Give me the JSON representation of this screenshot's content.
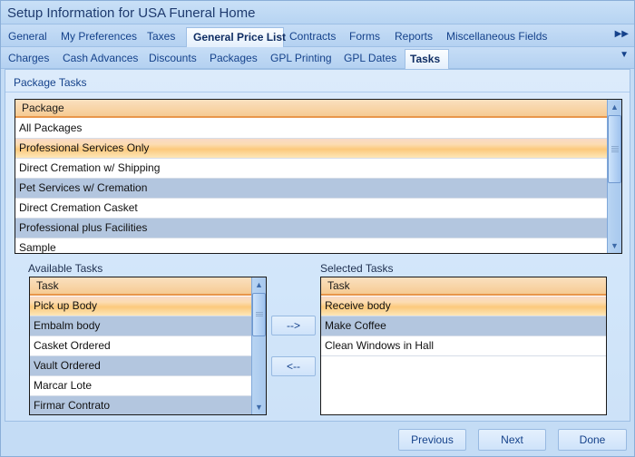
{
  "window": {
    "title": "Setup Information for USA Funeral Home"
  },
  "main_tabs": [
    {
      "label": "General"
    },
    {
      "label": "My Preferences"
    },
    {
      "label": "Taxes"
    },
    {
      "label": "General Price List",
      "active": true
    },
    {
      "label": "Contracts"
    },
    {
      "label": "Forms"
    },
    {
      "label": "Reports"
    },
    {
      "label": "Miscellaneous Fields"
    }
  ],
  "main_tabs_overflow_icon": "double-chevron-right-icon",
  "sub_tabs": [
    {
      "label": "Charges"
    },
    {
      "label": "Cash Advances"
    },
    {
      "label": "Discounts"
    },
    {
      "label": "Packages"
    },
    {
      "label": "GPL Printing"
    },
    {
      "label": "GPL Dates"
    },
    {
      "label": "Tasks",
      "active": true
    }
  ],
  "sub_tabs_overflow_icon": "triangle-down-icon",
  "panel": {
    "title": "Package Tasks",
    "packages": {
      "header": "Package",
      "rows": [
        {
          "label": "All Packages"
        },
        {
          "label": "Professional Services Only",
          "selected": true
        },
        {
          "label": "Direct Cremation w/ Shipping"
        },
        {
          "label": "Pet Services w/ Cremation"
        },
        {
          "label": "Direct Cremation Casket"
        },
        {
          "label": "Professional plus Facilities"
        },
        {
          "label": "Sample"
        }
      ]
    },
    "available": {
      "label": "Available Tasks",
      "header": "Task",
      "rows": [
        {
          "label": "Pick up Body",
          "selected": true
        },
        {
          "label": "Embalm body"
        },
        {
          "label": "Casket Ordered"
        },
        {
          "label": "Vault Ordered"
        },
        {
          "label": "Marcar Lote"
        },
        {
          "label": "Firmar Contrato"
        }
      ]
    },
    "selected": {
      "label": "Selected Tasks",
      "header": "Task",
      "rows": [
        {
          "label": "Receive body",
          "selected": true
        },
        {
          "label": "Make Coffee"
        },
        {
          "label": "Clean Windows in Hall"
        }
      ]
    },
    "add_button": "-->",
    "remove_button": "<--"
  },
  "footer": {
    "previous": "Previous",
    "next": "Next",
    "done": "Done"
  }
}
